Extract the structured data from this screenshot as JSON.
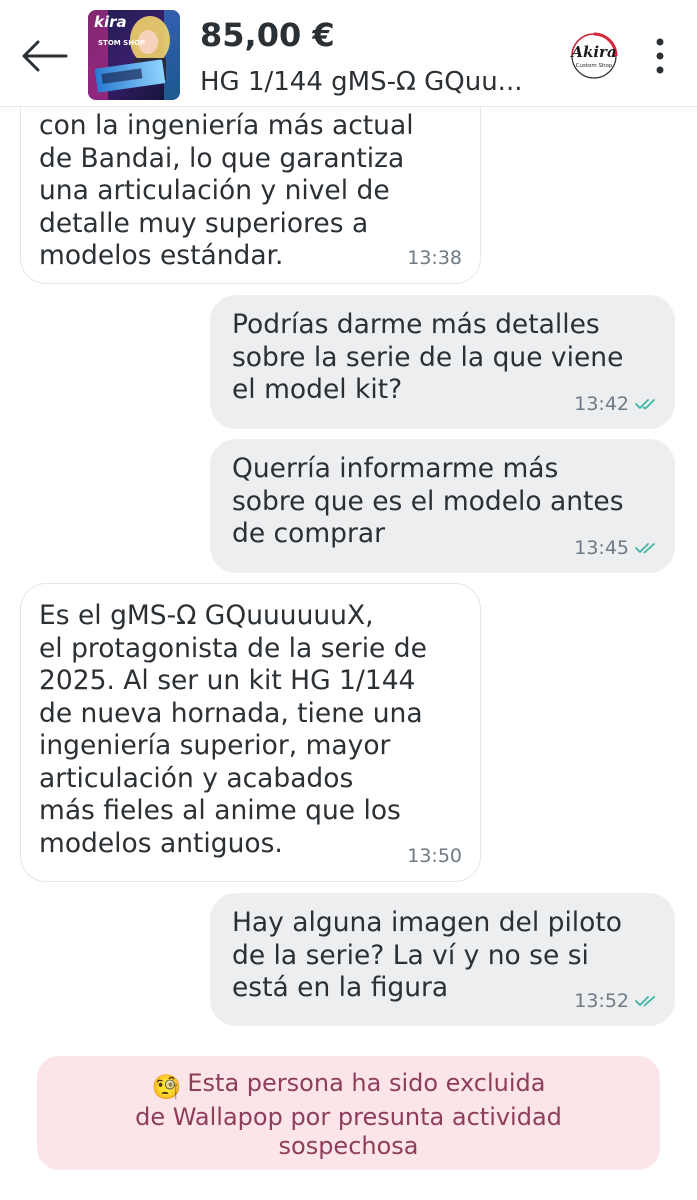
{
  "header": {
    "price": "85,00 €",
    "title": "HG 1/144 gMS-Ω GQuu...",
    "thumbnail_text_top": "kira",
    "thumbnail_text_mid": "STOM SHOP",
    "shop_logo_name": "Akira",
    "shop_logo_sub": "Custom Shop",
    "back_icon": "arrow-left-icon",
    "menu_icon": "more-vertical-icon"
  },
  "messages": [
    {
      "direction": "incoming",
      "text": "con la ingeniería más actual\nde Bandai, lo que garantiza\nuna articulación y nivel de\ndetalle muy superiores a\nmodelos estándar.",
      "time": "13:38"
    },
    {
      "direction": "outgoing",
      "text": "Podrías darme más detalles\nsobre la serie de la que viene\nel model kit?",
      "time": "13:42",
      "status_icon": "double-check-icon"
    },
    {
      "direction": "outgoing",
      "text": "Querría informarme más\nsobre que es el modelo antes\nde comprar",
      "time": "13:45",
      "status_icon": "double-check-icon"
    },
    {
      "direction": "incoming",
      "text": "Es el gMS-Ω GQuuuuuuX,\nel protagonista de la serie de\n2025. Al ser un kit HG 1/144\nde nueva hornada, tiene una\ningeniería superior, mayor\narticulación y acabados\nmás fieles al anime que los\nmodelos antiguos.",
      "time": "13:50"
    },
    {
      "direction": "outgoing",
      "text": "Hay alguna imagen del piloto\nde la serie? La ví y no se si\nestá en la figura",
      "time": "13:52",
      "status_icon": "double-check-icon"
    }
  ],
  "notice": {
    "emoji": "🧐",
    "text": "Esta persona ha sido excluida\nde Wallapop por presunta actividad\nsospechosa"
  },
  "colors": {
    "text": "#2b3035",
    "outgoing_bubble": "#eceef0",
    "incoming_border": "#e4e6e8",
    "timestamp": "#6e7a85",
    "read_check": "#3fb5a3",
    "notice_bg": "#fbe5e9",
    "notice_text": "#8e3e5a"
  }
}
